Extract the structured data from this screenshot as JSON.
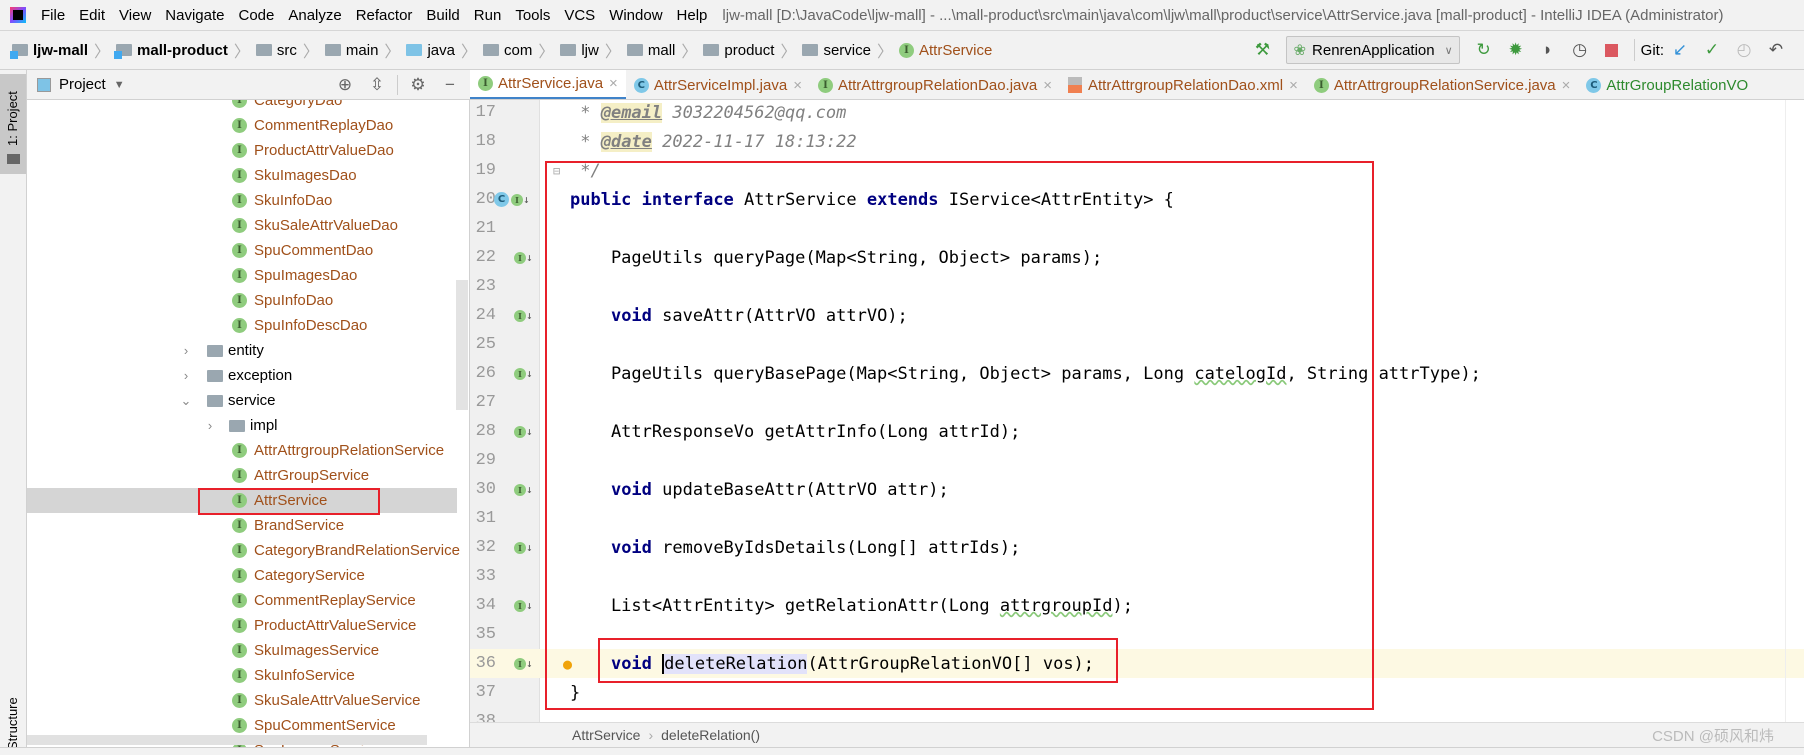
{
  "menu": {
    "items": [
      "File",
      "Edit",
      "View",
      "Navigate",
      "Code",
      "Analyze",
      "Refactor",
      "Build",
      "Run",
      "Tools",
      "VCS",
      "Window",
      "Help"
    ],
    "title": "ljw-mall [D:\\JavaCode\\ljw-mall] - ...\\mall-product\\src\\main\\java\\com\\ljw\\mall\\product\\service\\AttrService.java [mall-product] - IntelliJ IDEA (Administrator)"
  },
  "navbar": {
    "breadcrumbs": [
      "ljw-mall",
      "mall-product",
      "src",
      "main",
      "java",
      "com",
      "ljw",
      "mall",
      "product",
      "service",
      "AttrService"
    ],
    "run_config": "RenrenApplication",
    "git_label": "Git:"
  },
  "left_strip": {
    "project": "1: Project",
    "structure": "Structure"
  },
  "project_panel": {
    "title": "Project",
    "rows": [
      {
        "label": "CategoryDao",
        "type": "interface",
        "level": 2
      },
      {
        "label": "CommentReplayDao",
        "type": "interface",
        "level": 2
      },
      {
        "label": "ProductAttrValueDao",
        "type": "interface",
        "level": 2
      },
      {
        "label": "SkuImagesDao",
        "type": "interface",
        "level": 2
      },
      {
        "label": "SkuInfoDao",
        "type": "interface",
        "level": 2
      },
      {
        "label": "SkuSaleAttrValueDao",
        "type": "interface",
        "level": 2
      },
      {
        "label": "SpuCommentDao",
        "type": "interface",
        "level": 2
      },
      {
        "label": "SpuImagesDao",
        "type": "interface",
        "level": 2
      },
      {
        "label": "SpuInfoDao",
        "type": "interface",
        "level": 2
      },
      {
        "label": "SpuInfoDescDao",
        "type": "interface",
        "level": 2
      },
      {
        "label": "entity",
        "type": "folder",
        "level": 0,
        "expanded": false
      },
      {
        "label": "exception",
        "type": "folder",
        "level": 0,
        "expanded": false
      },
      {
        "label": "service",
        "type": "folder",
        "level": 0,
        "expanded": true
      },
      {
        "label": "impl",
        "type": "folder",
        "level": 1,
        "expanded": false
      },
      {
        "label": "AttrAttrgroupRelationService",
        "type": "interface",
        "level": 2
      },
      {
        "label": "AttrGroupService",
        "type": "interface",
        "level": 2
      },
      {
        "label": "AttrService",
        "type": "interface",
        "level": 2,
        "selected": true
      },
      {
        "label": "BrandService",
        "type": "interface",
        "level": 2
      },
      {
        "label": "CategoryBrandRelationService",
        "type": "interface",
        "level": 2
      },
      {
        "label": "CategoryService",
        "type": "interface",
        "level": 2
      },
      {
        "label": "CommentReplayService",
        "type": "interface",
        "level": 2
      },
      {
        "label": "ProductAttrValueService",
        "type": "interface",
        "level": 2
      },
      {
        "label": "SkuImagesService",
        "type": "interface",
        "level": 2
      },
      {
        "label": "SkuInfoService",
        "type": "interface",
        "level": 2
      },
      {
        "label": "SkuSaleAttrValueService",
        "type": "interface",
        "level": 2
      },
      {
        "label": "SpuCommentService",
        "type": "interface",
        "level": 2
      },
      {
        "label": "SpuImagesService",
        "type": "interface",
        "level": 2
      }
    ]
  },
  "tabs": [
    {
      "label": "AttrService.java",
      "icon": "I",
      "active": true
    },
    {
      "label": "AttrServiceImpl.java",
      "icon": "C"
    },
    {
      "label": "AttrAttrgroupRelationDao.java",
      "icon": "I"
    },
    {
      "label": "AttrAttrgroupRelationDao.xml",
      "icon": "xml"
    },
    {
      "label": "AttrAttrgroupRelationService.java",
      "icon": "I"
    },
    {
      "label": "AttrGroupRelationVO",
      "icon": "C",
      "color": "#2d8a2d"
    }
  ],
  "editor": {
    "lines": [
      {
        "n": "17",
        "tokens": [
          {
            "t": " * ",
            "c": "cm"
          },
          {
            "t": "@email",
            "c": "tag"
          },
          {
            "t": " 3032204562@qq.com",
            "c": "cm"
          }
        ]
      },
      {
        "n": "18",
        "tokens": [
          {
            "t": " * ",
            "c": "cm"
          },
          {
            "t": "@date",
            "c": "tag"
          },
          {
            "t": " 2022-11-17 18:13:22",
            "c": "cm"
          }
        ]
      },
      {
        "n": "19",
        "tokens": [
          {
            "t": " */",
            "c": "cm"
          }
        ]
      },
      {
        "n": "20",
        "gutter": "impl-and-interface",
        "tokens": [
          {
            "t": "public",
            "c": "kw"
          },
          {
            "t": " "
          },
          {
            "t": "interface",
            "c": "kw"
          },
          {
            "t": " AttrService "
          },
          {
            "t": "extends",
            "c": "kw"
          },
          {
            "t": " IService<AttrEntity> {"
          }
        ]
      },
      {
        "n": "21",
        "tokens": []
      },
      {
        "n": "22",
        "gutter": "interface",
        "tokens": [
          {
            "t": "    PageUtils queryPage(Map<String, Object> params);"
          }
        ]
      },
      {
        "n": "23",
        "tokens": []
      },
      {
        "n": "24",
        "gutter": "interface",
        "tokens": [
          {
            "t": "    "
          },
          {
            "t": "void",
            "c": "kw"
          },
          {
            "t": " saveAttr(AttrVO attrVO);"
          }
        ]
      },
      {
        "n": "25",
        "tokens": []
      },
      {
        "n": "26",
        "gutter": "interface",
        "tokens": [
          {
            "t": "    PageUtils queryBasePage(Map<String, Object> params, Long "
          },
          {
            "t": "catelogId",
            "c": "sq"
          },
          {
            "t": ", String attrType);"
          }
        ]
      },
      {
        "n": "27",
        "tokens": []
      },
      {
        "n": "28",
        "gutter": "interface",
        "tokens": [
          {
            "t": "    AttrResponseVo getAttrInfo(Long attrId);"
          }
        ]
      },
      {
        "n": "29",
        "tokens": []
      },
      {
        "n": "30",
        "gutter": "interface",
        "tokens": [
          {
            "t": "    "
          },
          {
            "t": "void",
            "c": "kw"
          },
          {
            "t": " updateBaseAttr(AttrVO attr);"
          }
        ]
      },
      {
        "n": "31",
        "tokens": []
      },
      {
        "n": "32",
        "gutter": "interface",
        "tokens": [
          {
            "t": "    "
          },
          {
            "t": "void",
            "c": "kw"
          },
          {
            "t": " removeByIdsDetails(Long[] attrIds);"
          }
        ]
      },
      {
        "n": "33",
        "tokens": []
      },
      {
        "n": "34",
        "gutter": "interface",
        "tokens": [
          {
            "t": "    List<AttrEntity> getRelationAttr(Long "
          },
          {
            "t": "attrgroupId",
            "c": "sq"
          },
          {
            "t": ");"
          }
        ]
      },
      {
        "n": "35",
        "tokens": []
      },
      {
        "n": "36",
        "gutter": "interface",
        "current": true,
        "tokens": [
          {
            "t": "    "
          },
          {
            "t": "void",
            "c": "kw"
          },
          {
            "t": " "
          },
          {
            "t": "deleteRelation",
            "c": "hl"
          },
          {
            "t": "(AttrGroupRelationVO[] vos);"
          }
        ]
      },
      {
        "n": "37",
        "tokens": [
          {
            "t": "}"
          }
        ]
      },
      {
        "n": "38",
        "tokens": []
      }
    ]
  },
  "bottom_breadcrumb": [
    "AttrService",
    "deleteRelation()"
  ],
  "watermark": "CSDN @硕风和炜",
  "colors": {
    "highlight_box": "#e8202a",
    "keyword": "#000080",
    "file_name": "#a0501a",
    "current_line": "#fdf9e3"
  }
}
